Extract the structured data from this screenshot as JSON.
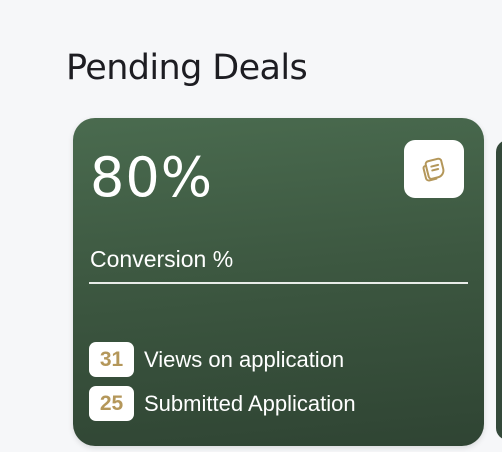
{
  "page": {
    "title": "Pending Deals"
  },
  "card": {
    "value": "80%",
    "label": "Conversion %",
    "icon": "notes-icon",
    "stats": [
      {
        "count": "31",
        "label": "Views on application"
      },
      {
        "count": "25",
        "label": "Submitted Application"
      }
    ]
  },
  "colors": {
    "card_background": "#3f5c44",
    "badge_text": "#b4975a",
    "icon": "#b4975a",
    "page_background": "#f6f7f9"
  }
}
